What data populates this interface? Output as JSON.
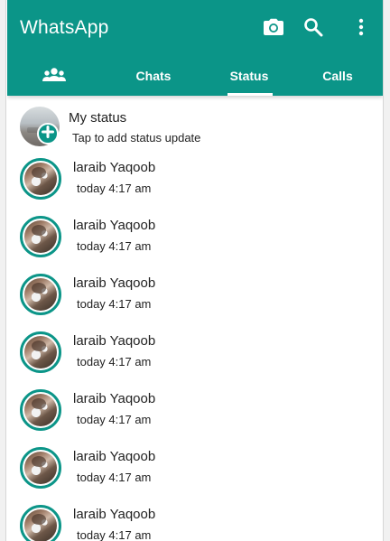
{
  "app": {
    "title": "WhatsApp",
    "accent": "#0b9588",
    "top_icons": [
      "camera-icon",
      "search-icon",
      "more-vert-icon"
    ]
  },
  "tabs": [
    {
      "label": "",
      "icon": "community-icon"
    },
    {
      "label": "Chats"
    },
    {
      "label": "Status",
      "active": true
    },
    {
      "label": "Calls"
    }
  ],
  "my_status": {
    "name": "My status",
    "subtitle": "Tap to add status update",
    "badge_icon": "add-icon"
  },
  "statuses": [
    {
      "name": "laraib Yaqoob",
      "time": "today 4:17 am"
    },
    {
      "name": "laraib Yaqoob",
      "time": "today 4:17 am"
    },
    {
      "name": "laraib Yaqoob",
      "time": "today 4:17 am"
    },
    {
      "name": "laraib Yaqoob",
      "time": "today 4:17 am"
    },
    {
      "name": "laraib Yaqoob",
      "time": "today 4:17 am"
    },
    {
      "name": "laraib Yaqoob",
      "time": "today 4:17 am"
    },
    {
      "name": "laraib Yaqoob",
      "time": "today 4:17 am"
    }
  ]
}
